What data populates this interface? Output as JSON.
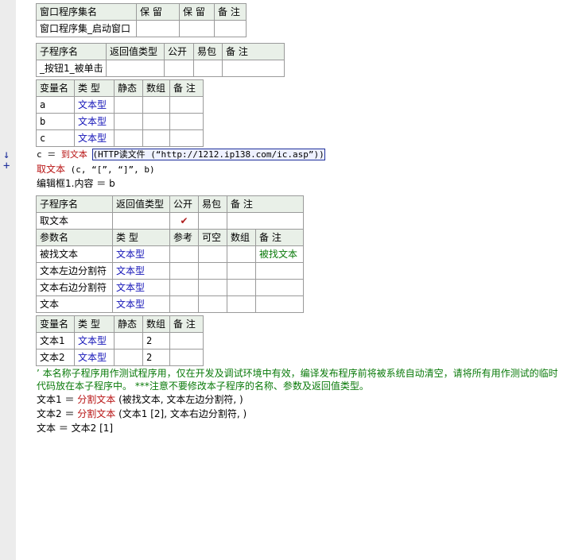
{
  "window_table": {
    "headers": [
      "窗口程序集名",
      "保 留",
      "保 留",
      "备 注"
    ],
    "row": [
      "窗口程序集_启动窗口",
      "",
      "",
      ""
    ]
  },
  "sub1_table": {
    "headers": [
      "子程序名",
      "返回值类型",
      "公开",
      "易包",
      "备 注"
    ],
    "row": [
      "_按钮1_被单击",
      "",
      "",
      "",
      ""
    ]
  },
  "var1_table": {
    "headers": [
      "变量名",
      "类 型",
      "静态",
      "数组",
      "备 注"
    ],
    "rows": [
      [
        "a",
        "文本型",
        "",
        "",
        ""
      ],
      [
        "b",
        "文本型",
        "",
        "",
        ""
      ],
      [
        "c",
        "文本型",
        "",
        "",
        ""
      ]
    ]
  },
  "gutter": {
    "marker": "↓ +"
  },
  "code1": {
    "line1": {
      "prefix": "c ＝ ",
      "fn": "到文本",
      "selected": "(HTTP读文件 (“http://1212.ip138.com/ic.asp”))"
    },
    "line2": {
      "fn": "取文本",
      "args": " (c, “[”, “]”, b)"
    },
    "line3": "编辑框1.内容 ＝ b"
  },
  "sub2_table": {
    "headers": [
      "子程序名",
      "返回值类型",
      "公开",
      "易包",
      "备 注"
    ],
    "row": [
      "取文本",
      "",
      "✔",
      "",
      ""
    ]
  },
  "param_table": {
    "headers": [
      "参数名",
      "类 型",
      "参考",
      "可空",
      "数组",
      "备 注"
    ],
    "rows": [
      [
        "被找文本",
        "文本型",
        "",
        "",
        "",
        "被找文本"
      ],
      [
        "文本左边分割符",
        "文本型",
        "",
        "",
        "",
        ""
      ],
      [
        "文本右边分割符",
        "文本型",
        "",
        "",
        "",
        ""
      ],
      [
        "文本",
        "文本型",
        "",
        "",
        "",
        ""
      ]
    ]
  },
  "var2_table": {
    "headers": [
      "变量名",
      "类 型",
      "静态",
      "数组",
      "备 注"
    ],
    "rows": [
      [
        "文本1",
        "文本型",
        "",
        "2",
        ""
      ],
      [
        "文本2",
        "文本型",
        "",
        "2",
        ""
      ]
    ]
  },
  "comment": "’ 本名称子程序用作测试程序用，仅在开发及调试环境中有效，编译发布程序前将被系统自动清空，请将所有用作测试的临时代码放在本子程序中。 ***注意不要修改本子程序的名称、参数及返回值类型。",
  "code2": {
    "line1": {
      "lhs": "文本1 ＝ ",
      "fn": "分割文本",
      "args": " (被找文本, 文本左边分割符, )"
    },
    "line2": {
      "lhs": "文本2 ＝ ",
      "fn": "分割文本",
      "args": " (文本1 [2], 文本右边分割符, )"
    },
    "line3": "文本 ＝ 文本2 [1]"
  }
}
